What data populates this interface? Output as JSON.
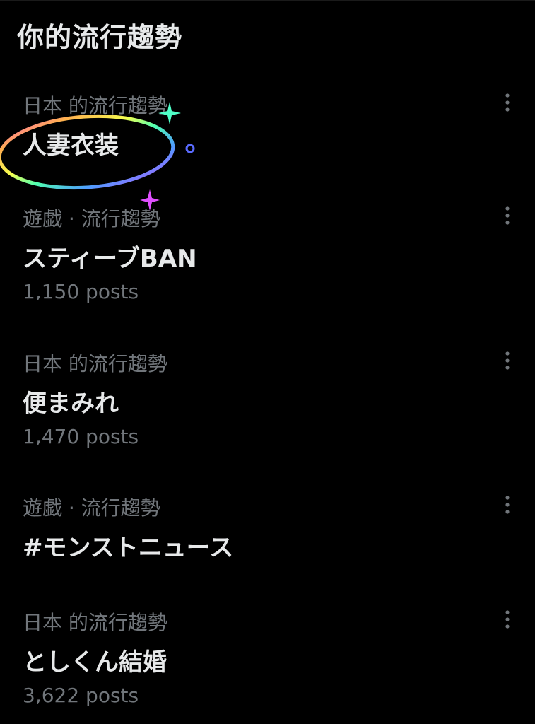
{
  "header": {
    "title": "你的流行趨勢"
  },
  "trends": [
    {
      "context": "日本 的流行趨勢",
      "name": "人妻衣装",
      "posts": ""
    },
    {
      "context": "遊戯 · 流行趨勢",
      "name": "スティーブBAN",
      "posts": "1,150 posts"
    },
    {
      "context": "日本 的流行趨勢",
      "name": "便まみれ",
      "posts": "1,470 posts"
    },
    {
      "context": "遊戯 · 流行趨勢",
      "name": "#モンストニュース",
      "posts": ""
    },
    {
      "context": "日本 的流行趨勢",
      "name": "としくん結婚",
      "posts": "3,622 posts"
    }
  ],
  "icons": {
    "more": "more-vertical-icon"
  },
  "colors": {
    "background": "#000000",
    "primary_text": "#e7e9ea",
    "secondary_text": "#71767b"
  }
}
